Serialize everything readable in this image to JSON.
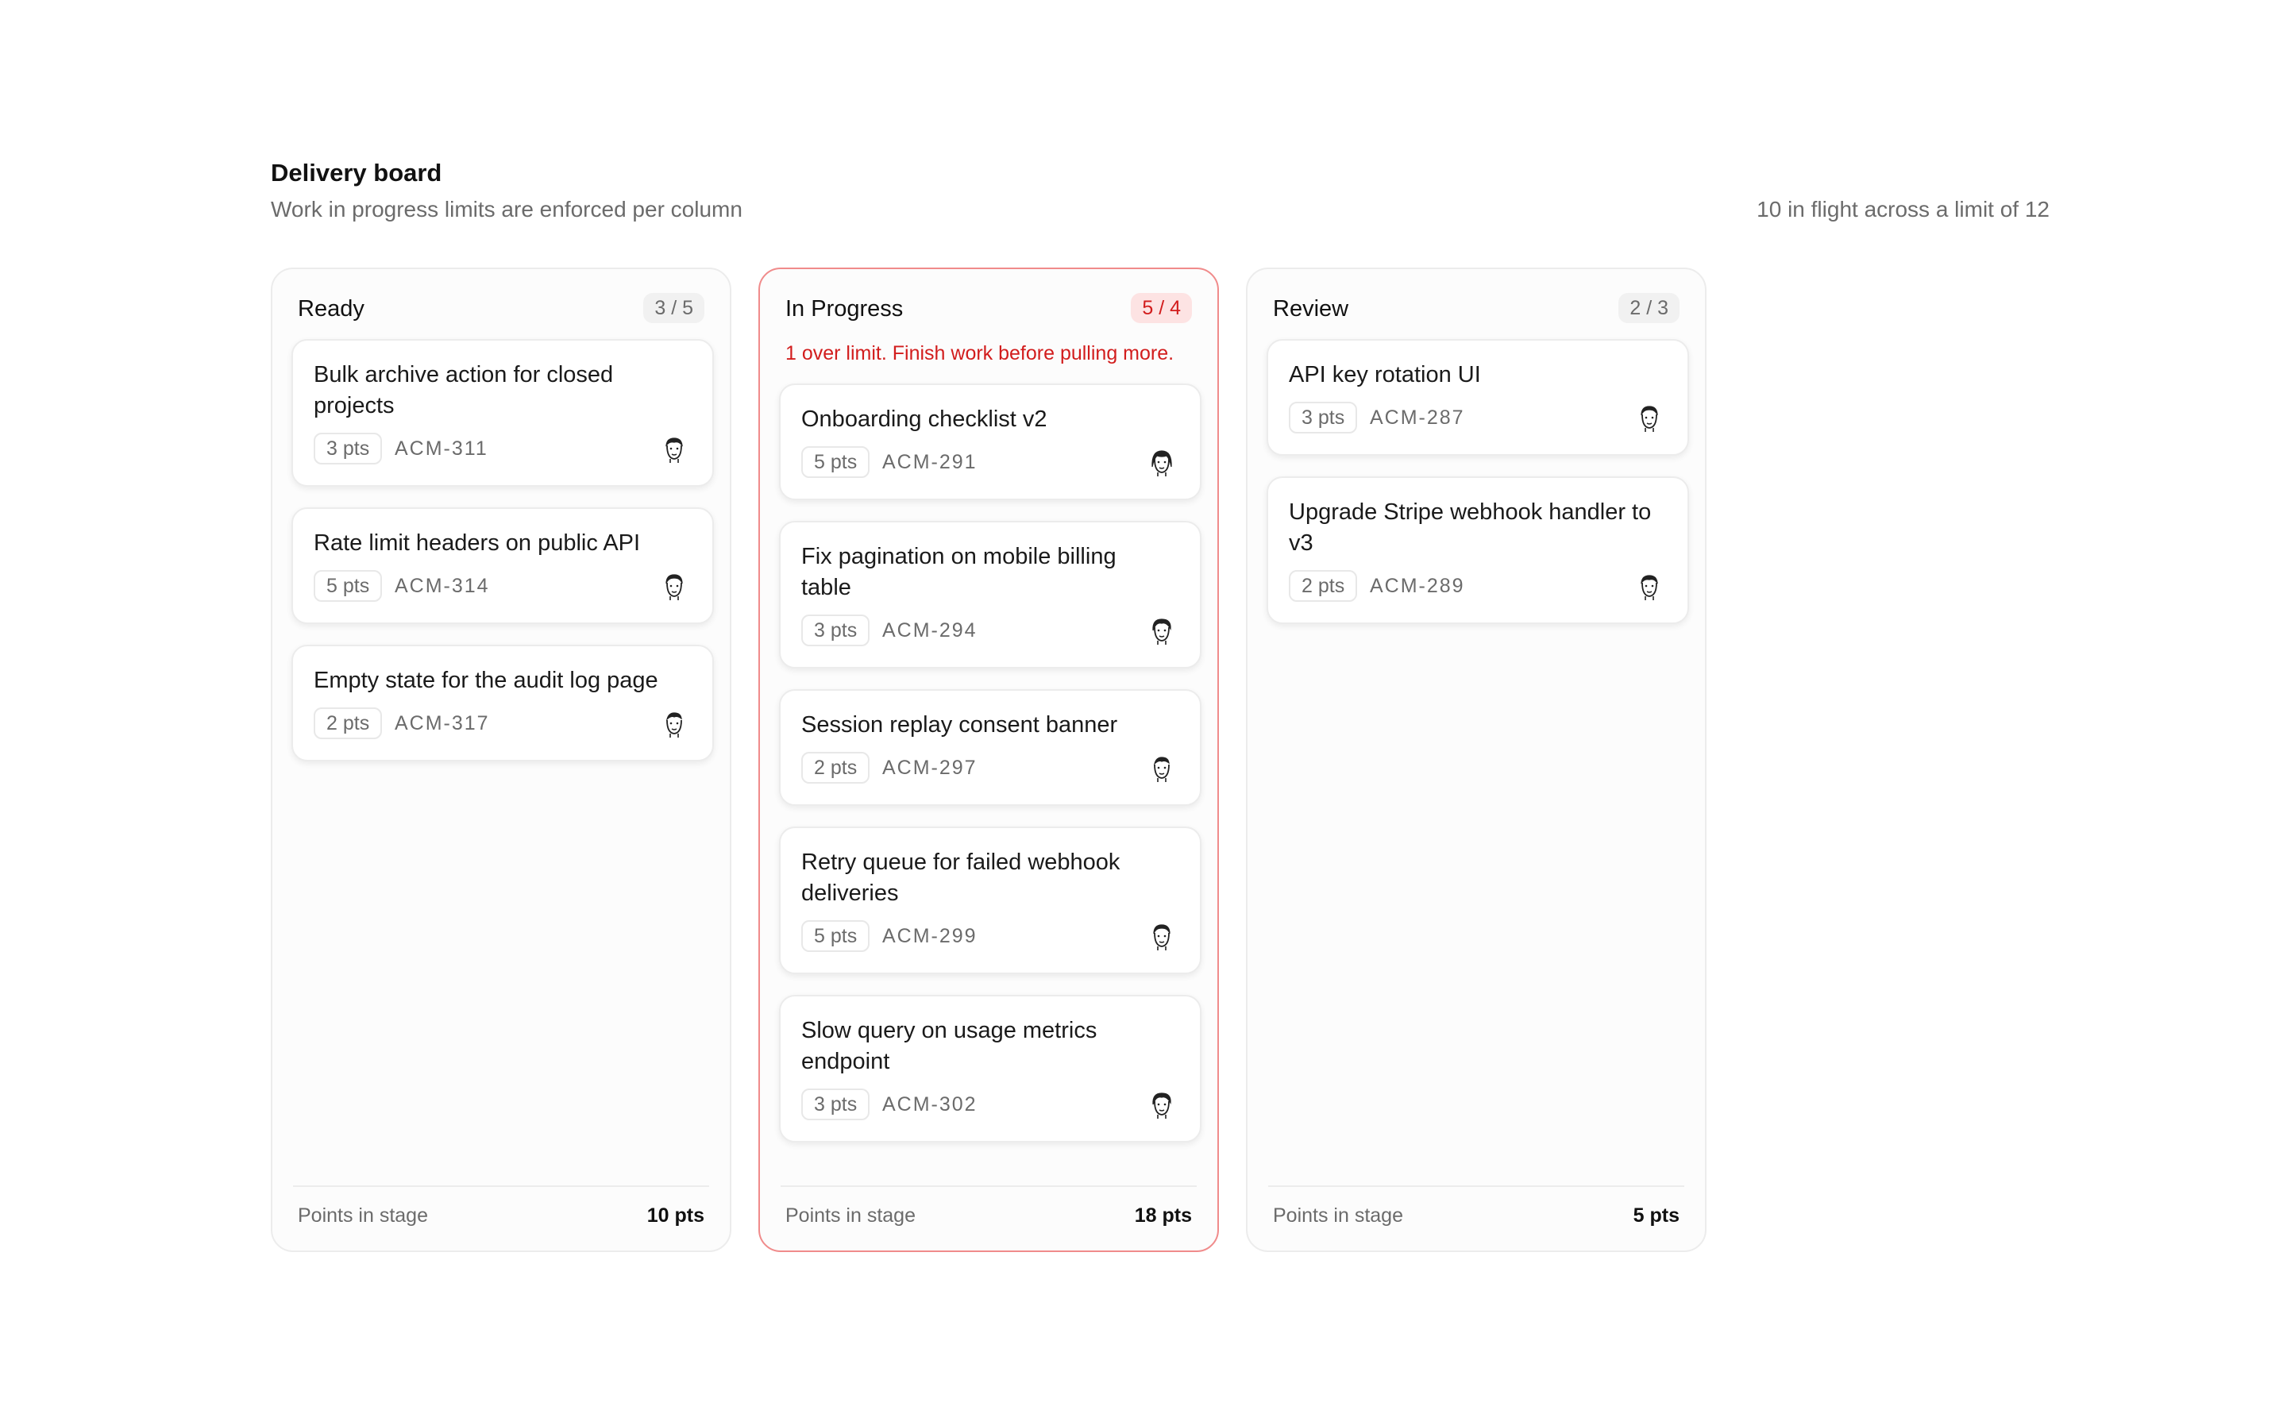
{
  "board": {
    "title": "Delivery board",
    "subtitle": "Work in progress limits are enforced per column",
    "summary": "10 in flight across a limit of 12"
  },
  "colors": {
    "over_limit": "#d21d1d",
    "over_limit_border": "#f08b8b",
    "muted_text": "#6b6b6b"
  },
  "columns": [
    {
      "title": "Ready",
      "count": "3 / 5",
      "over_limit": false,
      "warning": "",
      "footer_label": "Points in stage",
      "footer_total": "10 pts",
      "cards": [
        {
          "title": "Bulk archive action for closed projects",
          "points": "3 pts",
          "id": "ACM-311",
          "avatar": "avatar-icon"
        },
        {
          "title": "Rate limit headers on public API",
          "points": "5 pts",
          "id": "ACM-314",
          "avatar": "avatar-icon"
        },
        {
          "title": "Empty state for the audit log page",
          "points": "2 pts",
          "id": "ACM-317",
          "avatar": "avatar-icon"
        }
      ]
    },
    {
      "title": "In Progress",
      "count": "5 / 4",
      "over_limit": true,
      "warning": "1 over limit. Finish work before pulling more.",
      "footer_label": "Points in stage",
      "footer_total": "18 pts",
      "cards": [
        {
          "title": "Onboarding checklist v2",
          "points": "5 pts",
          "id": "ACM-291",
          "avatar": "avatar-icon"
        },
        {
          "title": "Fix pagination on mobile billing table",
          "points": "3 pts",
          "id": "ACM-294",
          "avatar": "avatar-icon"
        },
        {
          "title": "Session replay consent banner",
          "points": "2 pts",
          "id": "ACM-297",
          "avatar": "avatar-icon"
        },
        {
          "title": "Retry queue for failed webhook deliveries",
          "points": "5 pts",
          "id": "ACM-299",
          "avatar": "avatar-icon"
        },
        {
          "title": "Slow query on usage metrics endpoint",
          "points": "3 pts",
          "id": "ACM-302",
          "avatar": "avatar-icon"
        }
      ]
    },
    {
      "title": "Review",
      "count": "2 / 3",
      "over_limit": false,
      "warning": "",
      "footer_label": "Points in stage",
      "footer_total": "5 pts",
      "cards": [
        {
          "title": "API key rotation UI",
          "points": "3 pts",
          "id": "ACM-287",
          "avatar": "avatar-icon"
        },
        {
          "title": "Upgrade Stripe webhook handler to v3",
          "points": "2 pts",
          "id": "ACM-289",
          "avatar": "avatar-icon"
        }
      ]
    }
  ]
}
